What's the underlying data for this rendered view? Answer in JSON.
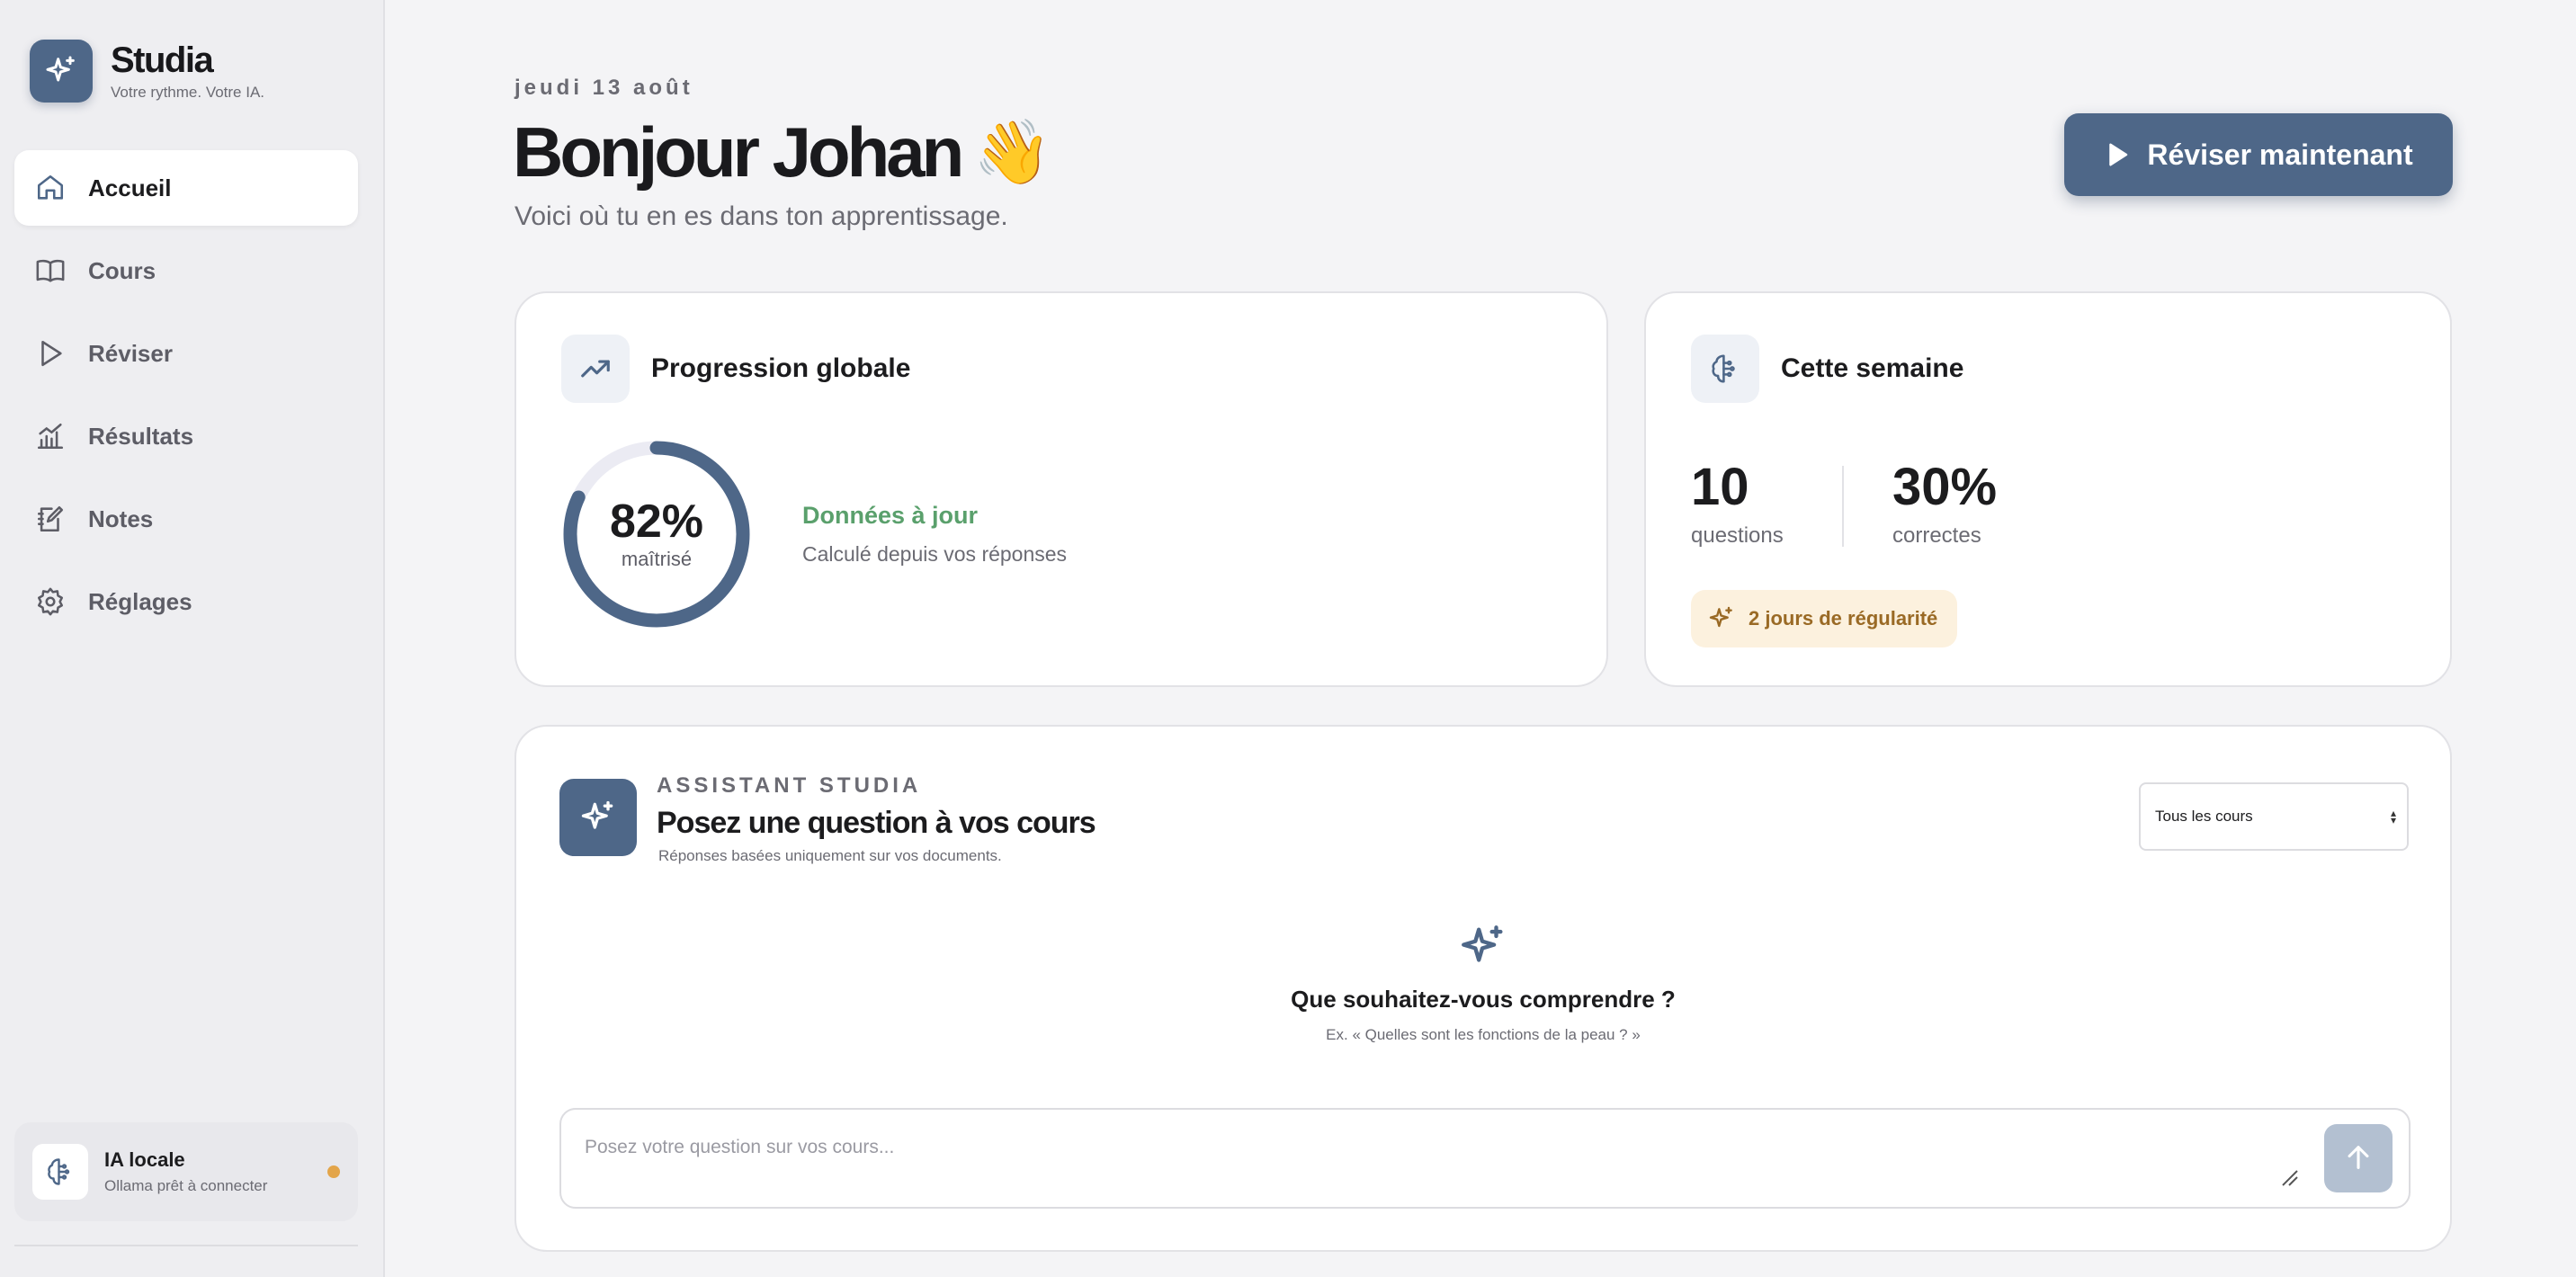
{
  "brand": {
    "name": "Studia",
    "tagline": "Votre rythme. Votre IA.",
    "icon": "sparkles-icon"
  },
  "nav": [
    {
      "label": "Accueil",
      "icon": "home-icon",
      "active": true
    },
    {
      "label": "Cours",
      "icon": "book-icon",
      "active": false
    },
    {
      "label": "Réviser",
      "icon": "play-icon",
      "active": false
    },
    {
      "label": "Résultats",
      "icon": "chart-icon",
      "active": false
    },
    {
      "label": "Notes",
      "icon": "note-icon",
      "active": false
    },
    {
      "label": "Réglages",
      "icon": "gear-icon",
      "active": false
    }
  ],
  "ai_status": {
    "title": "IA locale",
    "subtitle": "Ollama prêt à connecter",
    "dot_color": "#e3a54a",
    "icon": "brain-icon"
  },
  "header": {
    "date": "jeudi 13 août",
    "greeting": "Bonjour Johan",
    "emoji": "👋",
    "subtitle": "Voici où tu en es dans ton apprentissage.",
    "cta_label": "Réviser maintenant"
  },
  "progress": {
    "title": "Progression globale",
    "percent_label": "82%",
    "value": 0.82,
    "ring_caption": "maîtrisé",
    "status_title": "Données à jour",
    "status_subtitle": "Calculé depuis vos réponses"
  },
  "week": {
    "title": "Cette semaine",
    "questions_value": "10",
    "questions_label": "questions",
    "correct_value": "30%",
    "correct_label": "correctes",
    "streak_label": "2 jours de régularité"
  },
  "assistant": {
    "kicker": "ASSISTANT STUDIA",
    "title": "Posez une question à vos cours",
    "subtitle": "Réponses basées uniquement sur vos documents.",
    "course_select": "Tous les cours",
    "empty_title": "Que souhaitez-vous comprendre ?",
    "empty_example": "Ex. « Quelles sont les fonctions de la peau ? »",
    "input_placeholder": "Posez votre question sur vos cours..."
  },
  "colors": {
    "accent": "#4e6788",
    "success": "#5aa06c",
    "warning": "#e3a54a",
    "streak_bg": "#fcf1de",
    "streak_text": "#9a6a25"
  }
}
